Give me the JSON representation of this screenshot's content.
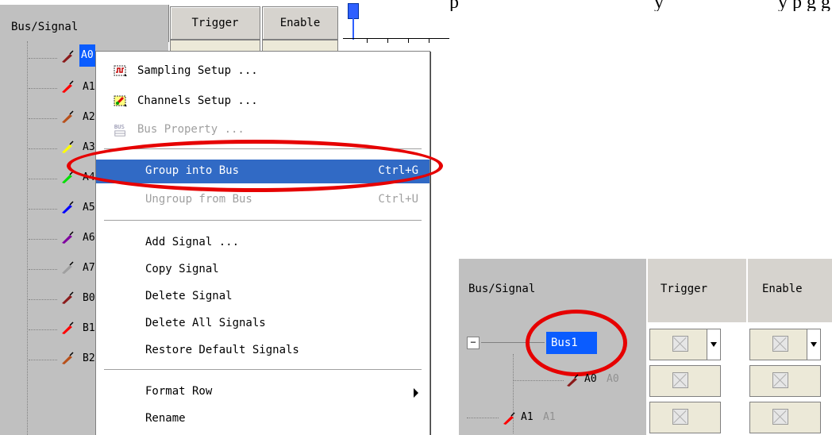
{
  "background_text": {
    "left": "p",
    "middle": "y",
    "right": "y p g      g   y"
  },
  "left_panel": {
    "header": {
      "bus_signal": "Bus/Signal",
      "trigger": "Trigger",
      "enable": "Enable"
    },
    "signals": [
      {
        "label": "A0",
        "color": "#8b1a1a",
        "selected": true
      },
      {
        "label": "A1",
        "color": "#ff0000"
      },
      {
        "label": "A2",
        "color": "#b8501a"
      },
      {
        "label": "A3",
        "color": "#ffff00"
      },
      {
        "label": "A4",
        "color": "#00e000"
      },
      {
        "label": "A5",
        "color": "#0000ff"
      },
      {
        "label": "A6",
        "color": "#8000a0"
      },
      {
        "label": "A7",
        "color": "#a0a0a0"
      },
      {
        "label": "B0",
        "color": "#8b1a1a"
      },
      {
        "label": "B1",
        "color": "#ff0000"
      },
      {
        "label": "B2",
        "color": "#b8501a"
      }
    ]
  },
  "context_menu": {
    "sampling_setup": "Sampling Setup ...",
    "channels_setup": "Channels Setup ...",
    "bus_property": "Bus Property ...",
    "bus_icon_text": "BUS",
    "group_into_bus": "Group into Bus",
    "group_into_bus_shortcut": "Ctrl+G",
    "ungroup_from_bus": "Ungroup from Bus",
    "ungroup_from_bus_shortcut": "Ctrl+U",
    "add_signal": "Add Signal ...",
    "copy_signal": "Copy Signal",
    "delete_signal": "Delete Signal",
    "delete_all_signals": "Delete All Signals",
    "restore_default_signals": "Restore Default Signals",
    "format_row": "Format Row",
    "rename": "Rename"
  },
  "right_panel": {
    "header": {
      "bus_signal": "Bus/Signal",
      "trigger": "Trigger",
      "enable": "Enable"
    },
    "bus_label": "Bus1",
    "collapse_symbol": "−",
    "rows": [
      {
        "label": "A0",
        "alias": "A0",
        "color": "#8b1a1a"
      },
      {
        "label": "A1",
        "alias": "A1",
        "color": "#ff0000"
      }
    ]
  },
  "colors": {
    "highlight": "#316ac5",
    "selection": "#0a5cff",
    "annotation_ellipse": "#e60000",
    "panel_gray": "#c0c0c0"
  }
}
